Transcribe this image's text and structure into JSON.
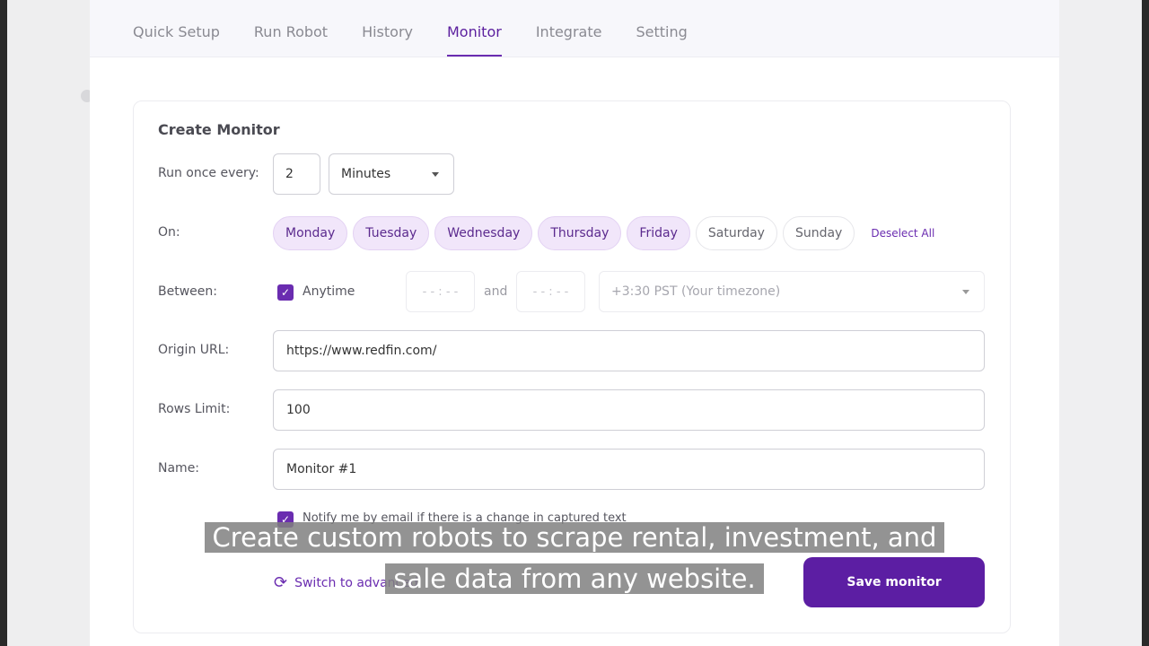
{
  "nav": {
    "tabs": [
      {
        "label": "Quick Setup",
        "active": false
      },
      {
        "label": "Run Robot",
        "active": false
      },
      {
        "label": "History",
        "active": false
      },
      {
        "label": "Monitor",
        "active": true
      },
      {
        "label": "Integrate",
        "active": false
      },
      {
        "label": "Setting",
        "active": false
      }
    ]
  },
  "form": {
    "title": "Create Monitor",
    "run_once_label": "Run once every:",
    "interval_value": "2",
    "interval_unit": "Minutes",
    "on_label": "On:",
    "days": [
      {
        "label": "Monday",
        "selected": true
      },
      {
        "label": "Tuesday",
        "selected": true
      },
      {
        "label": "Wednesday",
        "selected": true
      },
      {
        "label": "Thursday",
        "selected": true
      },
      {
        "label": "Friday",
        "selected": true
      },
      {
        "label": "Saturday",
        "selected": false
      },
      {
        "label": "Sunday",
        "selected": false
      }
    ],
    "deselect_all": "Deselect All",
    "between_label": "Between:",
    "anytime_label": "Anytime",
    "anytime_checked": true,
    "start_time_placeholder": "- - : - -",
    "and_text": "and",
    "end_time_placeholder": "- - : - -",
    "timezone": "+3:30 PST (Your timezone)",
    "origin_url_label": "Origin URL:",
    "origin_url": "https://www.redfin.com/",
    "rows_limit_label": "Rows Limit:",
    "rows_limit": "100",
    "name_label": "Name:",
    "name": "Monitor #1",
    "notify_label": "Notify me by email if there is a change in captured text",
    "notify_checked": true,
    "switch_link": "Switch to advanced",
    "save_button": "Save monitor"
  },
  "caption": {
    "line1": "Create custom robots to scrape rental, investment, and",
    "line2": "sale data from any website."
  },
  "colors": {
    "accent": "#5c1ea3",
    "day_selected_bg": "#f1e6fa",
    "caption_bg": "#808080"
  }
}
